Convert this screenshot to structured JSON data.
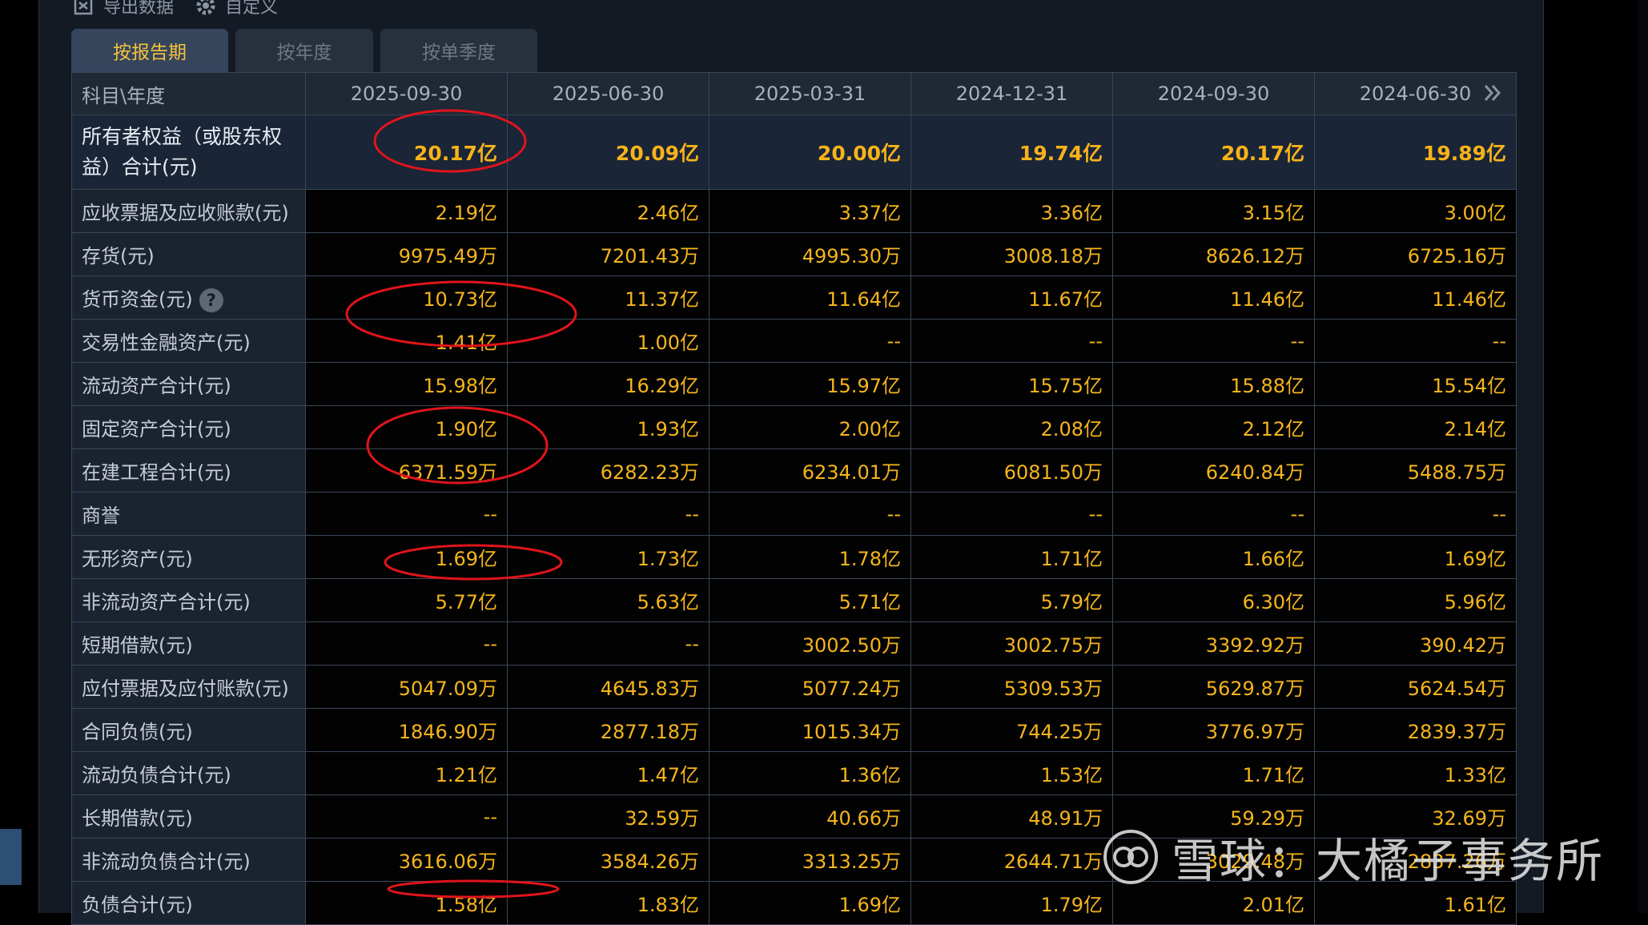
{
  "toolbar": {
    "export_label": "导出数据",
    "export_icon": "export-data-icon",
    "custom_label": "自定义",
    "custom_icon": "gear-icon"
  },
  "tabs": [
    {
      "label": "按报告期",
      "active": true
    },
    {
      "label": "按年度",
      "active": false
    },
    {
      "label": "按单季度",
      "active": false
    }
  ],
  "table": {
    "header_label": "科目\\年度",
    "dates": [
      "2025-09-30",
      "2025-06-30",
      "2025-03-31",
      "2024-12-31",
      "2024-09-30",
      "2024-06-30"
    ],
    "next_icon": "double-chevron-right-icon",
    "rows": [
      {
        "label": "所有者权益（或股东权益）合计(元)",
        "values": [
          "20.17亿",
          "20.09亿",
          "20.00亿",
          "19.74亿",
          "20.17亿",
          "19.89亿"
        ]
      },
      {
        "label": "应收票据及应收账款(元)",
        "values": [
          "2.19亿",
          "2.46亿",
          "3.37亿",
          "3.36亿",
          "3.15亿",
          "3.00亿"
        ]
      },
      {
        "label": "存货(元)",
        "values": [
          "9975.49万",
          "7201.43万",
          "4995.30万",
          "3008.18万",
          "8626.12万",
          "6725.16万"
        ]
      },
      {
        "label": "货币资金(元)",
        "help": "?",
        "values": [
          "10.73亿",
          "11.37亿",
          "11.64亿",
          "11.67亿",
          "11.46亿",
          "11.46亿"
        ]
      },
      {
        "label": "交易性金融资产(元)",
        "values": [
          "1.41亿",
          "1.00亿",
          "--",
          "--",
          "--",
          "--"
        ]
      },
      {
        "label": "流动资产合计(元)",
        "values": [
          "15.98亿",
          "16.29亿",
          "15.97亿",
          "15.75亿",
          "15.88亿",
          "15.54亿"
        ]
      },
      {
        "label": "固定资产合计(元)",
        "values": [
          "1.90亿",
          "1.93亿",
          "2.00亿",
          "2.08亿",
          "2.12亿",
          "2.14亿"
        ]
      },
      {
        "label": "在建工程合计(元)",
        "values": [
          "6371.59万",
          "6282.23万",
          "6234.01万",
          "6081.50万",
          "6240.84万",
          "5488.75万"
        ]
      },
      {
        "label": "商誉",
        "values": [
          "--",
          "--",
          "--",
          "--",
          "--",
          "--"
        ]
      },
      {
        "label": "无形资产(元)",
        "values": [
          "1.69亿",
          "1.73亿",
          "1.78亿",
          "1.71亿",
          "1.66亿",
          "1.69亿"
        ]
      },
      {
        "label": "非流动资产合计(元)",
        "values": [
          "5.77亿",
          "5.63亿",
          "5.71亿",
          "5.79亿",
          "6.30亿",
          "5.96亿"
        ]
      },
      {
        "label": "短期借款(元)",
        "values": [
          "--",
          "--",
          "3002.50万",
          "3002.75万",
          "3392.92万",
          "390.42万"
        ]
      },
      {
        "label": "应付票据及应付账款(元)",
        "values": [
          "5047.09万",
          "4645.83万",
          "5077.24万",
          "5309.53万",
          "5629.87万",
          "5624.54万"
        ]
      },
      {
        "label": "合同负债(元)",
        "values": [
          "1846.90万",
          "2877.18万",
          "1015.34万",
          "744.25万",
          "3776.97万",
          "2839.37万"
        ]
      },
      {
        "label": "流动负债合计(元)",
        "values": [
          "1.21亿",
          "1.47亿",
          "1.36亿",
          "1.53亿",
          "1.71亿",
          "1.33亿"
        ]
      },
      {
        "label": "长期借款(元)",
        "values": [
          "--",
          "32.59万",
          "40.66万",
          "48.91万",
          "59.29万",
          "32.69万"
        ]
      },
      {
        "label": "非流动负债合计(元)",
        "values": [
          "3616.06万",
          "3584.26万",
          "3313.25万",
          "2644.71万",
          "3029.48万",
          "2837.26万"
        ]
      },
      {
        "label": "负债合计(元)",
        "values": [
          "1.58亿",
          "1.83亿",
          "1.69亿",
          "1.79亿",
          "2.01亿",
          "1.61亿"
        ]
      }
    ]
  },
  "watermark": {
    "icon": "xueqiu-logo-icon",
    "text": "雪球：大橘子事务所"
  },
  "colors": {
    "value": "#f6b51c",
    "active_tab_text": "#f5c33b",
    "annotation": "#e0141c"
  }
}
